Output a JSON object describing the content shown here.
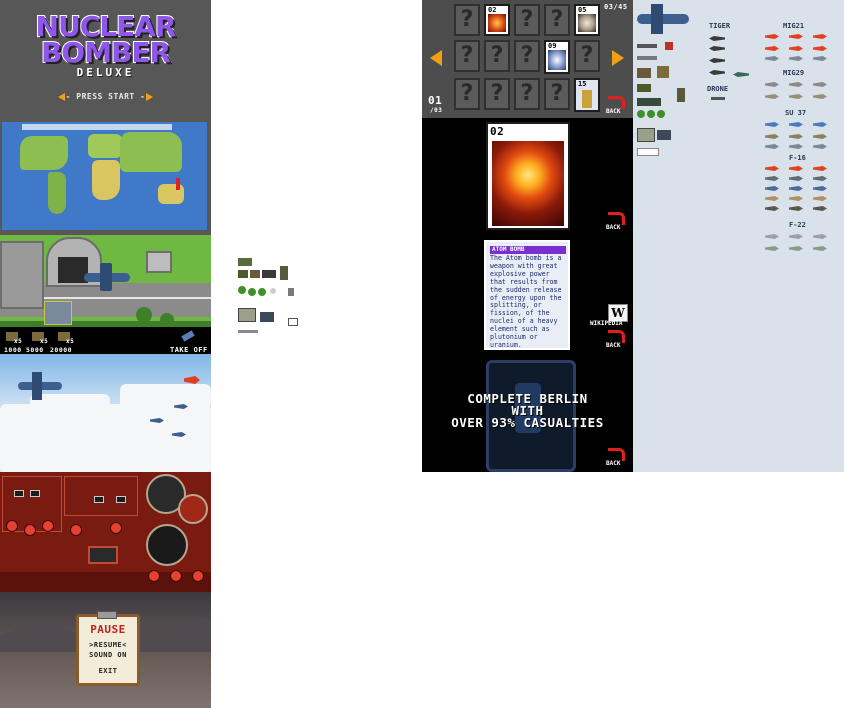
{
  "title_screen": {
    "title_line1": "NUCLEAR",
    "title_line2": "BOMBER",
    "title_line3": "DELUXE",
    "press_start": "- PRESS START -"
  },
  "airbase_hud": {
    "counts": [
      "x5",
      "x5",
      "x5"
    ],
    "prices": [
      "1000",
      "5000",
      "20000"
    ],
    "takeoff_label": "TAKE OFF"
  },
  "pause_menu": {
    "title": "PAUSE",
    "resume": ">RESUME<",
    "sound": "SOUND ON",
    "exit": "EXIT"
  },
  "collection": {
    "progress": "03/45",
    "page_number": "01",
    "page_total": "/03",
    "visible_cards": [
      "02",
      "05",
      "09",
      "15"
    ],
    "unknown_glyph": "?",
    "back_label": "BACK"
  },
  "card_detail": {
    "number": "02",
    "info_title": "ATOM BOMB",
    "info_text": "The Atom bomb is a weapon with great explosive power that results from the sudden release of energy upon the splitting, or fission, of the nuclei of a heavy element such as plutonium or uranium.",
    "wikipedia_label": "WIKIPEDIA",
    "back_label": "BACK"
  },
  "mission": {
    "line1": "COMPLETE BERLIN",
    "line2": "WITH",
    "line3": "OVER 93% CASUALTIES",
    "back_label": "BACK"
  },
  "aircraft_sheet": {
    "labels": [
      "TIGER",
      "DRONE",
      "MIG21",
      "MIG29",
      "SU 37",
      "F-16",
      "F-22"
    ]
  },
  "colors": {
    "accent_purple": "#8f57e8",
    "accent_orange": "#f0a010",
    "back_red": "#e02020",
    "sheet_bg": "#d9e1ea"
  }
}
